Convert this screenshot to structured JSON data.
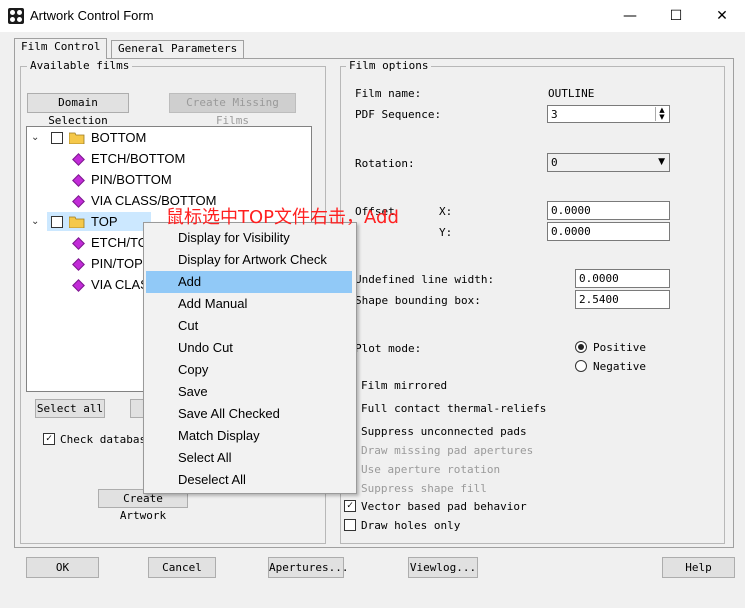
{
  "window": {
    "title": "Artwork Control Form",
    "minimize_glyph": "—",
    "maximize_glyph": "☐",
    "close_glyph": "✕"
  },
  "tabs": [
    {
      "label": "Film Control"
    },
    {
      "label": "General Parameters"
    }
  ],
  "available_films": {
    "label": "Available films",
    "domain_selection": "Domain Selection",
    "create_missing": "Create Missing Films",
    "tree": [
      {
        "label": "BOTTOM"
      },
      {
        "label": "ETCH/BOTTOM"
      },
      {
        "label": "PIN/BOTTOM"
      },
      {
        "label": "VIA CLASS/BOTTOM"
      },
      {
        "label": "TOP"
      },
      {
        "label": "ETCH/TO"
      },
      {
        "label": "PIN/TOP"
      },
      {
        "label": "VIA CLAS"
      }
    ],
    "select_all": "Select all",
    "check_database": "Check database",
    "create_artwork": "Create Artwork"
  },
  "context_menu": {
    "items": [
      "Display for Visibility",
      "Display for Artwork Check",
      "Add",
      "Add Manual",
      "Cut",
      "Undo Cut",
      "Copy",
      "Save",
      "Save All Checked",
      "Match Display",
      "Select All",
      "Deselect All"
    ],
    "highlighted": "Add"
  },
  "annotation": "鼠标选中TOP文件右击，Add",
  "film_options": {
    "label": "Film options",
    "film_name_label": "Film name:",
    "film_name_value": "OUTLINE",
    "pdf_sequence_label": "PDF Sequence:",
    "pdf_sequence_value": "3",
    "rotation_label": "Rotation:",
    "rotation_value": "0",
    "offset_label": "Offset",
    "x_label": "X:",
    "x_value": "0.0000",
    "y_label": "Y:",
    "y_value": "0.0000",
    "undefined_line_width_label": "Undefined line width:",
    "undefined_line_width_value": "0.0000",
    "shape_bounding_box_label": "Shape bounding box:",
    "shape_bounding_box_value": "2.5400",
    "plot_mode_label": "Plot mode:",
    "positive": "Positive",
    "negative": "Negative",
    "film_mirrored": "Film mirrored",
    "full_contact": "Full contact thermal-reliefs",
    "suppress_unconnected": "Suppress unconnected pads",
    "draw_missing": "Draw missing pad apertures",
    "use_aperture_rotation": "Use aperture rotation",
    "suppress_shape_fill": "Suppress shape fill",
    "vector_based": "Vector based pad behavior",
    "draw_holes_only": "Draw holes only"
  },
  "footer": {
    "ok": "OK",
    "cancel": "Cancel",
    "apertures": "Apertures...",
    "viewlog": "Viewlog...",
    "help": "Help"
  }
}
